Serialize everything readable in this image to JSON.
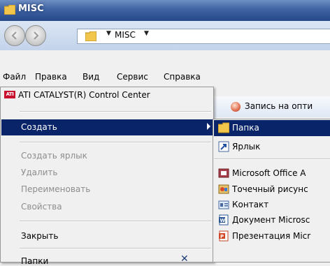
{
  "window": {
    "title": "MISC"
  },
  "addressbar": {
    "path": "MISC"
  },
  "menubar": {
    "items": [
      "Файл",
      "Правка",
      "Вид",
      "Сервис",
      "Справка"
    ]
  },
  "toolbar": {
    "burn_label": "Запись на опти"
  },
  "file_menu": {
    "catalyst": "ATI CATALYST(R) Control Center",
    "create": "Создать",
    "create_shortcut": "Создать ярлык",
    "delete": "Удалить",
    "rename": "Переименовать",
    "properties": "Свойства",
    "close": "Закрыть"
  },
  "folders_pane": {
    "label": "Папки",
    "close_glyph": "✕"
  },
  "submenu": {
    "items": [
      "Папка",
      "Ярлык",
      "Microsoft Office A",
      "Точечный рисунс",
      "Контакт",
      "Документ Microsc",
      "Презентация Micr"
    ]
  },
  "colors": {
    "highlight": "#0a246a",
    "titlebar": "#3f63a3"
  }
}
